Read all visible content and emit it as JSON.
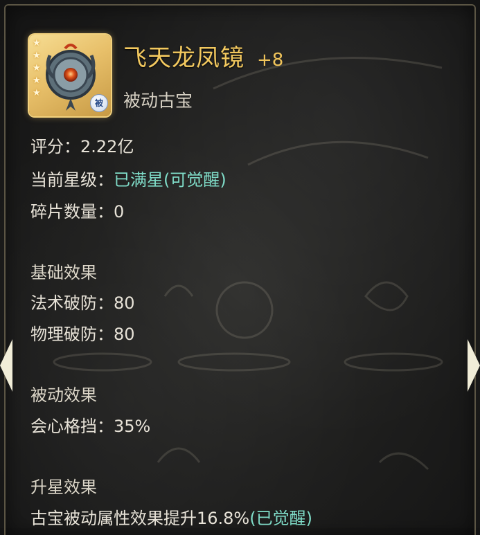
{
  "item": {
    "name": "飞天龙凤镜",
    "level": "+8",
    "type": "被动古宝",
    "badge": "被",
    "stars": 5
  },
  "stats": {
    "score_label": "评分：",
    "score_value": "2.22亿",
    "star_label": "当前星级：",
    "star_value": "已满星(可觉醒)",
    "shard_label": "碎片数量：",
    "shard_value": "0"
  },
  "base_effect": {
    "title": "基础效果",
    "magic_pen_label": "法术破防：",
    "magic_pen_value": "80",
    "phys_pen_label": "物理破防：",
    "phys_pen_value": "80"
  },
  "passive_effect": {
    "title": "被动效果",
    "crit_block_label": "会心格挡：",
    "crit_block_value": "35%"
  },
  "upgrade_effect": {
    "title": "升星效果",
    "text": "古宝被动属性效果提升16.8%",
    "status": "(已觉醒)"
  },
  "colors": {
    "gold": "#f3c95f",
    "teal": "#7fdcc8",
    "text": "#e8e3d8"
  }
}
